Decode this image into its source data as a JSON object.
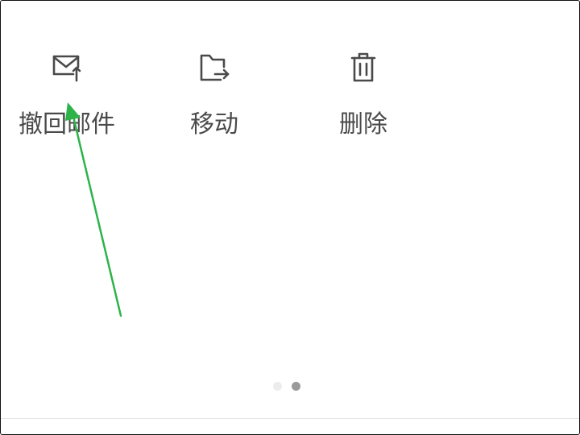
{
  "actions": {
    "recall_mail": {
      "label": "撤回邮件",
      "icon": "mail-recall-icon"
    },
    "move": {
      "label": "移动",
      "icon": "folder-move-icon"
    },
    "delete": {
      "label": "删除",
      "icon": "trash-icon"
    }
  },
  "pager": {
    "page_count": 2,
    "active_index": 2
  },
  "colors": {
    "icon": "#4a4a4a",
    "label": "#4a4a4a",
    "annotation_arrow": "#2db34a",
    "dot_active": "#9a9a9a",
    "dot_inactive": "#ececec"
  }
}
